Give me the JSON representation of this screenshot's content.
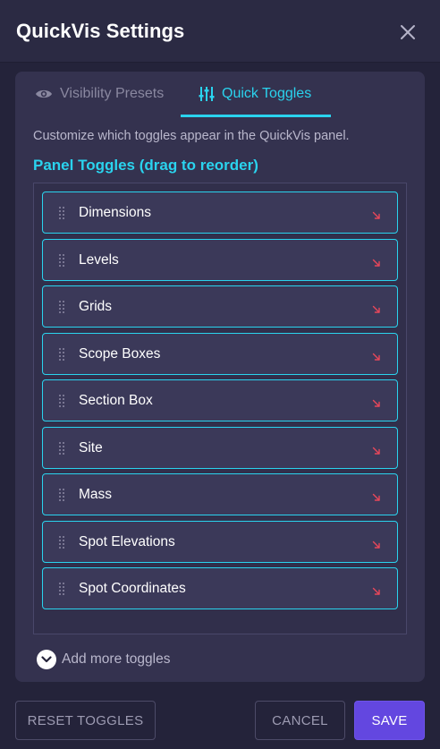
{
  "dialog": {
    "title": "QuickVis Settings",
    "close_icon": "close-icon"
  },
  "tabs": [
    {
      "label": "Visibility Presets",
      "icon": "eye-icon",
      "active": false
    },
    {
      "label": "Quick Toggles",
      "icon": "sliders-icon",
      "active": true
    }
  ],
  "main": {
    "description": "Customize which toggles appear in the QuickVis panel.",
    "section_heading": "Panel Toggles (drag to reorder)",
    "items": [
      {
        "label": "Dimensions"
      },
      {
        "label": "Levels"
      },
      {
        "label": "Grids"
      },
      {
        "label": "Scope Boxes"
      },
      {
        "label": "Section Box"
      },
      {
        "label": "Site"
      },
      {
        "label": "Mass"
      },
      {
        "label": "Spot Elevations"
      },
      {
        "label": "Spot Coordinates"
      }
    ],
    "add_more_label": "Add more toggles"
  },
  "footer": {
    "reset_label": "RESET TOGGLES",
    "cancel_label": "CANCEL",
    "save_label": "SAVE"
  },
  "colors": {
    "accent": "#2ad3ee",
    "primary_button": "#6347e0",
    "item_arrow": "#e8475a",
    "background": "#24233a",
    "card": "#34324f"
  }
}
